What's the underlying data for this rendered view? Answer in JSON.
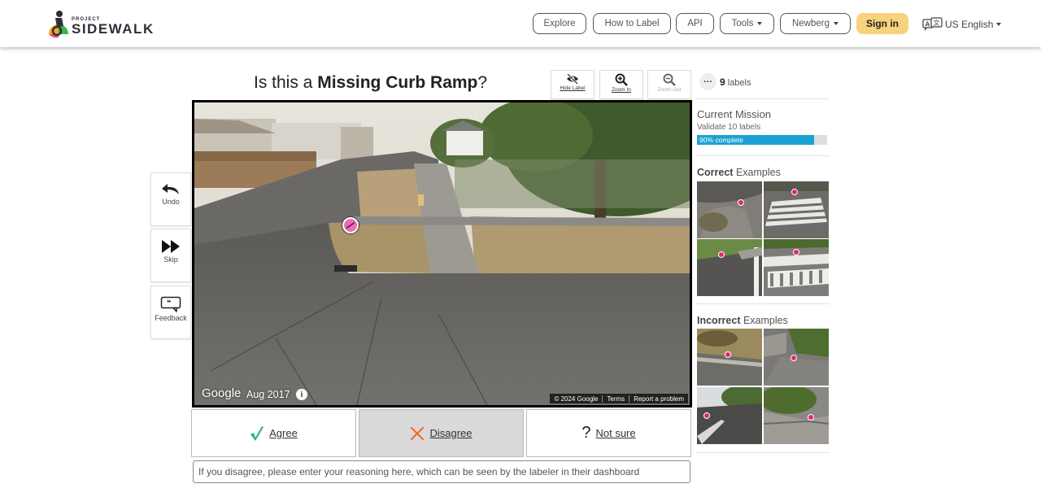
{
  "nav": {
    "logo_small": "PROJECT",
    "logo_big": "SIDEWALK",
    "explore": "Explore",
    "how_to_label": "How to Label",
    "api": "API",
    "tools": "Tools",
    "city": "Newberg",
    "sign_in": "Sign in",
    "language": "US English"
  },
  "question": {
    "prefix": "Is this a ",
    "label_type": "Missing Curb Ramp",
    "suffix": "?"
  },
  "toolbar": {
    "hide_label": "Hide Label",
    "zoom_in": "Zoom In",
    "zoom_out": "Zoom Out",
    "more": "···",
    "labels_count": "9",
    "labels_word": "labels"
  },
  "side_tools": {
    "undo": "Undo",
    "skip": "Skip",
    "feedback": "Feedback"
  },
  "pano": {
    "google": "Google",
    "date": "Aug 2017",
    "info": "i",
    "copyright": "© 2024 Google",
    "terms": "Terms",
    "report": "Report a problem"
  },
  "vote": {
    "agree": "Agree",
    "disagree": "Disagree",
    "not_sure": "Not sure",
    "selected": "disagree"
  },
  "reason_placeholder": "If you disagree, please enter your reasoning here, which can be seen by the labeler in their dashboard",
  "mission": {
    "title": "Current Mission",
    "subtitle": "Validate 10 labels",
    "progress": 0.9,
    "progress_text": "90% complete"
  },
  "examples": {
    "correct_bold": "Correct",
    "incorrect_bold": "Incorrect",
    "suffix": " Examples"
  },
  "colors": {
    "progress": "#1ba1d1",
    "signin": "#f8d37b",
    "agree_check": "#2bb673",
    "disagree_x": "#f26b2a",
    "marker": "#e86fb5"
  }
}
